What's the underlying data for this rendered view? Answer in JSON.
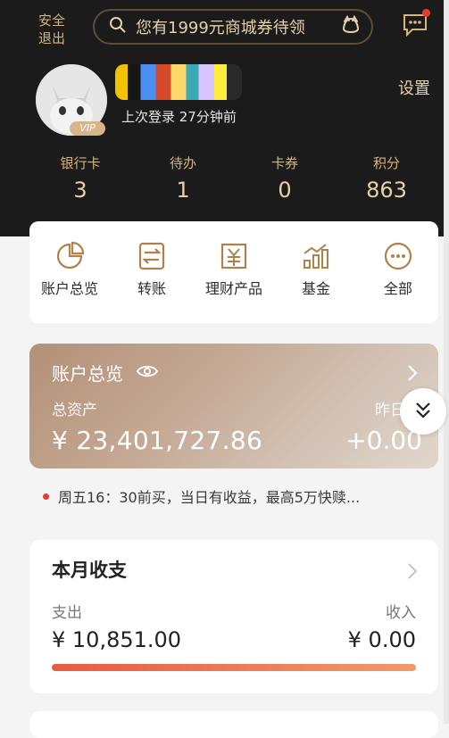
{
  "header": {
    "logout_label": "安全退出",
    "search": {
      "placeholder": "您有1999元商城券待领"
    },
    "icons": {
      "search": "search-icon",
      "voice": "voice-icon",
      "message": "message-icon"
    }
  },
  "profile": {
    "badge": "VIP",
    "last_login": "上次登录 27分钟前",
    "settings_label": "设置"
  },
  "stats": [
    {
      "label": "银行卡",
      "value": "3"
    },
    {
      "label": "待办",
      "value": "1"
    },
    {
      "label": "卡券",
      "value": "0"
    },
    {
      "label": "积分",
      "value": "863"
    }
  ],
  "shortcuts": [
    {
      "label": "账户总览",
      "icon": "pie-chart-icon"
    },
    {
      "label": "转账",
      "icon": "transfer-icon"
    },
    {
      "label": "理财产品",
      "icon": "wealth-products-icon"
    },
    {
      "label": "基金",
      "icon": "fund-chart-icon"
    },
    {
      "label": "全部",
      "icon": "more-icon"
    }
  ],
  "assets": {
    "title": "账户总览",
    "total_label": "总资产",
    "total_value": "¥ 23,401,727.86",
    "yesterday_label": "昨日收",
    "yesterday_value": "+0.00"
  },
  "notice": {
    "text": "周五16：30前买，当日有收益，最高5万快赎..."
  },
  "monthly": {
    "title": "本月收支",
    "expense_label": "支出",
    "expense_value": "¥ 10,851.00",
    "income_label": "收入",
    "income_value": "¥ 0.00"
  },
  "colors": {
    "header_bg": "#1b1b1b",
    "gold": "#d8b37a",
    "accent": "#e85b3e"
  }
}
